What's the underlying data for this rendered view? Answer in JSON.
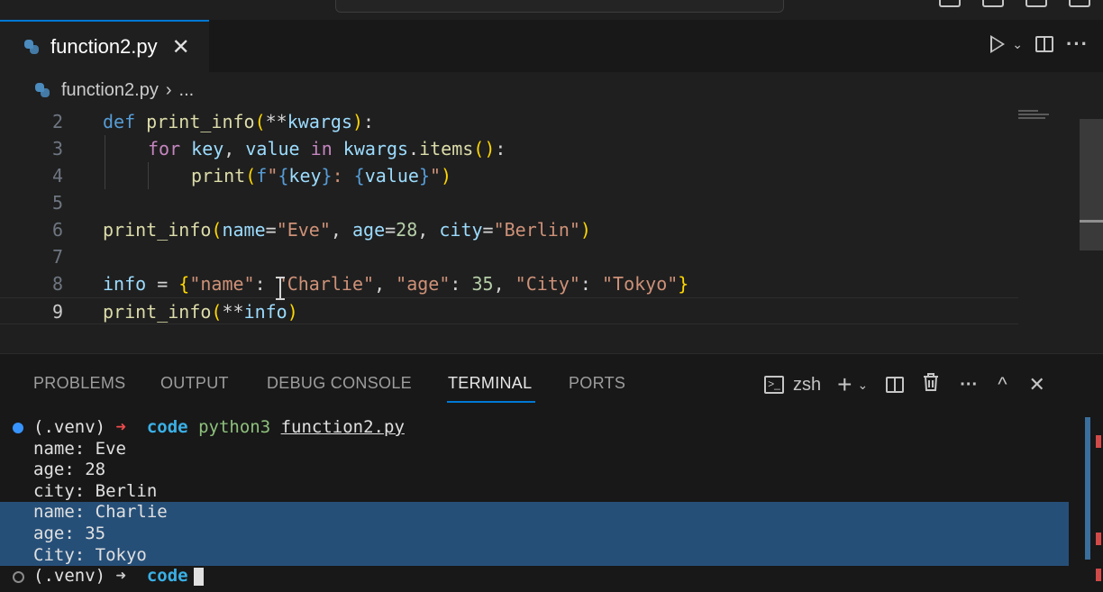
{
  "tab": {
    "label": "function2.py",
    "close": "✕"
  },
  "editor_actions": {
    "chevron": "⌄",
    "more": "···"
  },
  "breadcrumb": {
    "file": "function2.py",
    "separator": "›",
    "more": "..."
  },
  "code": {
    "lines": [
      {
        "num": "2"
      },
      {
        "num": "3"
      },
      {
        "num": "4"
      },
      {
        "num": "5"
      },
      {
        "num": "6"
      },
      {
        "num": "7"
      },
      {
        "num": "8"
      },
      {
        "num": "9"
      }
    ],
    "l2": {
      "def": "def",
      "name": "print_info",
      "open": "(",
      "star": "**",
      "param": "kwargs",
      "close": ")",
      "colon": ":"
    },
    "l3": {
      "for": "for",
      "key": "key",
      "comma": ", ",
      "value": "value",
      "in": " in ",
      "kw": "kwargs",
      "dot": ".",
      "items": "items",
      "paren": "()",
      "colon": ":"
    },
    "l4": {
      "print": "print",
      "open": "(",
      "f": "f",
      "q1": "\"",
      "b1o": "{",
      "key": "key",
      "b1c": "}",
      "mid": ": ",
      "b2o": "{",
      "value": "value",
      "b2c": "}",
      "q2": "\"",
      "close": ")"
    },
    "l6": {
      "fn": "print_info",
      "open": "(",
      "name": "name",
      "eq": "=",
      "eve": "\"Eve\"",
      "c1": ", ",
      "age": "age",
      "eq2": "=",
      "n28": "28",
      "c2": ", ",
      "city": "city",
      "eq3": "=",
      "berlin": "\"Berlin\"",
      "close": ")"
    },
    "l8": {
      "info": "info",
      "eq": " = ",
      "open": "{",
      "k1": "\"name\"",
      "c1": ": ",
      "v1": "\"Charlie\"",
      "s1": ", ",
      "k2": "\"age\"",
      "c2": ": ",
      "v2": "35",
      "s2": ", ",
      "k3": "\"City\"",
      "c3": ": ",
      "v3": "\"Tokyo\"",
      "close": "}"
    },
    "l9": {
      "fn": "print_info",
      "open": "(",
      "star": "**",
      "arg": "info",
      "close": ")"
    }
  },
  "panel": {
    "tabs": [
      "PROBLEMS",
      "OUTPUT",
      "DEBUG CONSOLE",
      "TERMINAL",
      "PORTS"
    ],
    "active_tab": "TERMINAL",
    "shell": "zsh",
    "terminal_icon": ">_",
    "add": "+",
    "add_chevron": "⌄",
    "more": "···",
    "maximize": "^",
    "close": "✕"
  },
  "terminal": {
    "prompt_env": "(.venv) ",
    "arrow": "➜",
    "dir": "code",
    "command": "python3",
    "arg": "function2.py",
    "output": [
      "name: Eve",
      "age: 28",
      "city: Berlin",
      "name: Charlie",
      "age: 35",
      "City: Tokyo"
    ],
    "prompt2_env": "(.venv) ",
    "prompt2_dir": "code"
  },
  "colors": {
    "accent": "#0078d4",
    "selection": "#264f78",
    "keyword": "#569cd6",
    "function": "#dcdcaa",
    "string": "#ce9178",
    "variable": "#9cdcfe",
    "number": "#b5cea8"
  }
}
